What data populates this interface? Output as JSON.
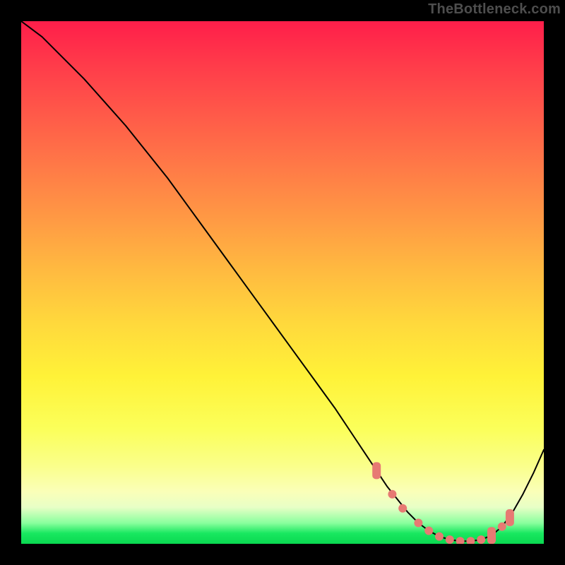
{
  "watermark": "TheBottleneck.com",
  "chart_data": {
    "type": "line",
    "title": "",
    "xlabel": "",
    "ylabel": "",
    "xlim": [
      0,
      100
    ],
    "ylim": [
      0,
      100
    ],
    "series": [
      {
        "name": "bottleneck-curve",
        "x": [
          0,
          4,
          8,
          12,
          16,
          20,
          24,
          28,
          32,
          36,
          40,
          44,
          48,
          52,
          56,
          60,
          64,
          66,
          68,
          70,
          72,
          74,
          76,
          78,
          80,
          82,
          84,
          86,
          88,
          90,
          92,
          94,
          96,
          98,
          100
        ],
        "y": [
          100,
          97,
          93,
          89,
          84.5,
          80,
          75,
          70,
          64.5,
          59,
          53.5,
          48,
          42.5,
          37,
          31.5,
          26,
          20,
          17,
          14,
          11,
          8.5,
          6,
          4,
          2.5,
          1.4,
          0.8,
          0.5,
          0.5,
          0.8,
          1.6,
          3.3,
          6,
          9.5,
          13.5,
          18
        ]
      }
    ],
    "markers": {
      "name": "highlight-region",
      "color": "#e77a73",
      "points": [
        {
          "x": 68,
          "y": 14,
          "shape": "pill"
        },
        {
          "x": 71,
          "y": 9.5,
          "shape": "dot"
        },
        {
          "x": 73,
          "y": 6.8,
          "shape": "dot"
        },
        {
          "x": 76,
          "y": 4,
          "shape": "dot"
        },
        {
          "x": 78,
          "y": 2.5,
          "shape": "dot"
        },
        {
          "x": 80,
          "y": 1.4,
          "shape": "dot"
        },
        {
          "x": 82,
          "y": 0.8,
          "shape": "dot"
        },
        {
          "x": 84,
          "y": 0.5,
          "shape": "dot"
        },
        {
          "x": 86,
          "y": 0.5,
          "shape": "dot"
        },
        {
          "x": 88,
          "y": 0.8,
          "shape": "dot"
        },
        {
          "x": 90,
          "y": 1.6,
          "shape": "pill"
        },
        {
          "x": 92,
          "y": 3.3,
          "shape": "dot"
        },
        {
          "x": 93.5,
          "y": 5,
          "shape": "pill"
        }
      ]
    },
    "gradient_stops": [
      {
        "pos": 0,
        "color": "#ff1e4a"
      },
      {
        "pos": 50,
        "color": "#ffd93c"
      },
      {
        "pos": 80,
        "color": "#fbff5a"
      },
      {
        "pos": 100,
        "color": "#0ad850"
      }
    ]
  }
}
